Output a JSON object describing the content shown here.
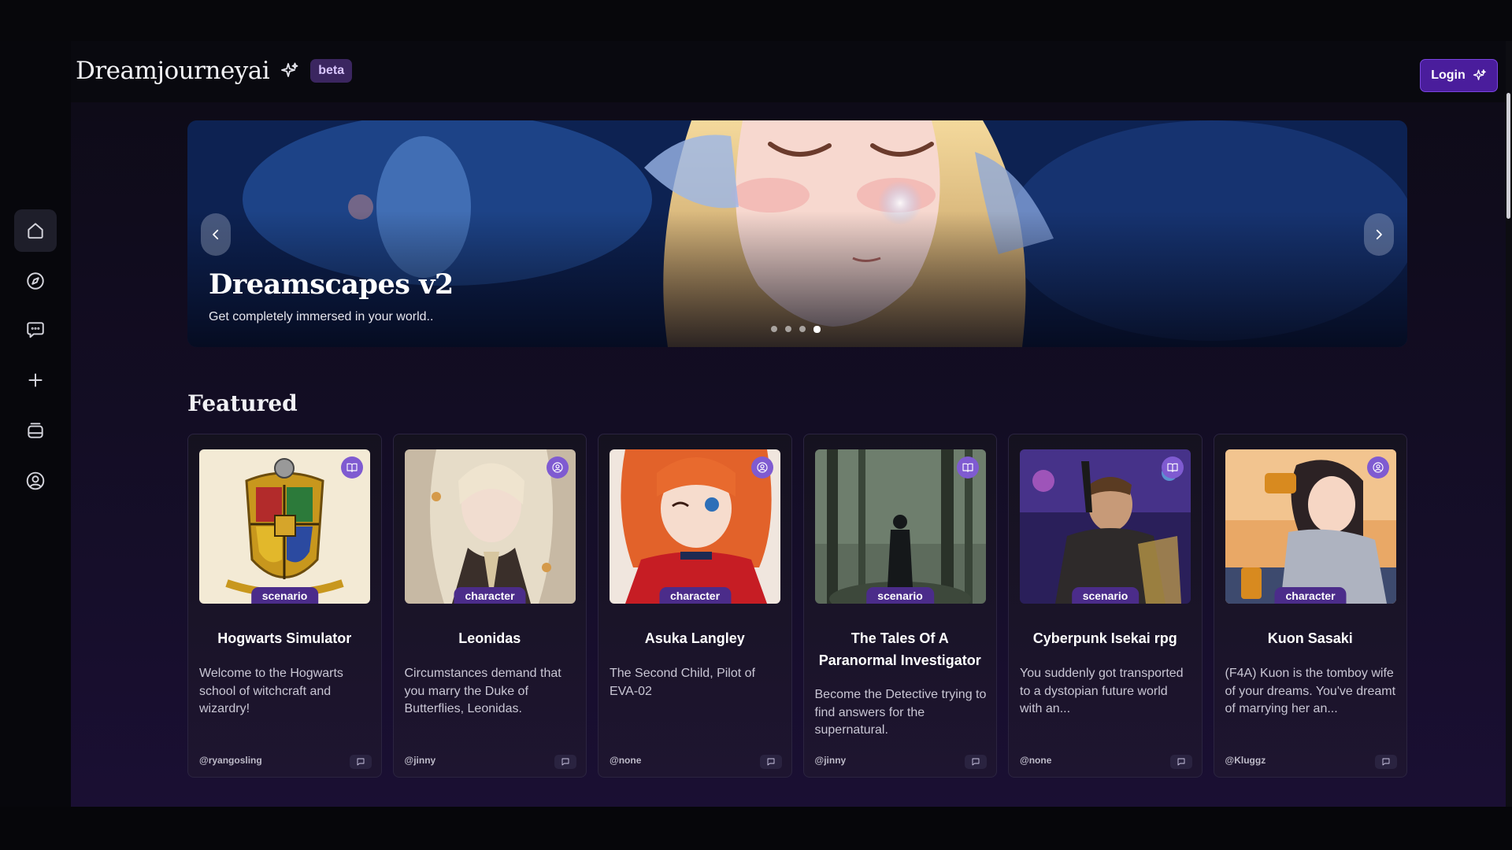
{
  "brand": {
    "name": "Dreamjourneyai",
    "badge": "beta"
  },
  "header": {
    "login_label": "Login"
  },
  "sidebar": {
    "items": [
      {
        "icon": "home-icon",
        "active": true
      },
      {
        "icon": "compass-icon",
        "active": false
      },
      {
        "icon": "chat-icon",
        "active": false
      },
      {
        "icon": "plus-icon",
        "active": false
      },
      {
        "icon": "library-icon",
        "active": false
      },
      {
        "icon": "profile-icon",
        "active": false
      }
    ]
  },
  "hero": {
    "title": "Dreamscapes v2",
    "subtitle": "Get completely immersed in your world..",
    "slide_count": 4,
    "active_slide": 4
  },
  "featured": {
    "heading": "Featured",
    "cards": [
      {
        "title": "Hogwarts Simulator",
        "type": "scenario",
        "type_icon": "book-icon",
        "description": "Welcome to the Hogwarts school of witchcraft and wizardry!",
        "author": "@ryangosling"
      },
      {
        "title": "Leonidas",
        "type": "character",
        "type_icon": "person-icon",
        "description": "Circumstances demand that you marry the Duke of Butterflies, Leonidas.",
        "author": "@jinny"
      },
      {
        "title": "Asuka Langley",
        "type": "character",
        "type_icon": "person-icon",
        "description": "The Second Child, Pilot of EVA-02",
        "author": "@none"
      },
      {
        "title": "The Tales Of A Paranormal Investigator",
        "type": "scenario",
        "type_icon": "book-icon",
        "description": "Become the Detective trying to find answers for the supernatural.",
        "author": "@jinny"
      },
      {
        "title": "Cyberpunk Isekai rpg",
        "type": "scenario",
        "type_icon": "book-icon",
        "description": "You suddenly got transported to a dystopian future world with an...",
        "author": "@none"
      },
      {
        "title": "Kuon Sasaki",
        "type": "character",
        "type_icon": "person-icon",
        "description": "(F4A) Kuon is the tomboy wife of your dreams. You've dreamt of marrying her an...",
        "author": "@Kluggz"
      }
    ]
  },
  "colors": {
    "accent": "#4a1d9c",
    "badge": "#4b2c8a",
    "corner_icon": "#7f5bd1"
  }
}
